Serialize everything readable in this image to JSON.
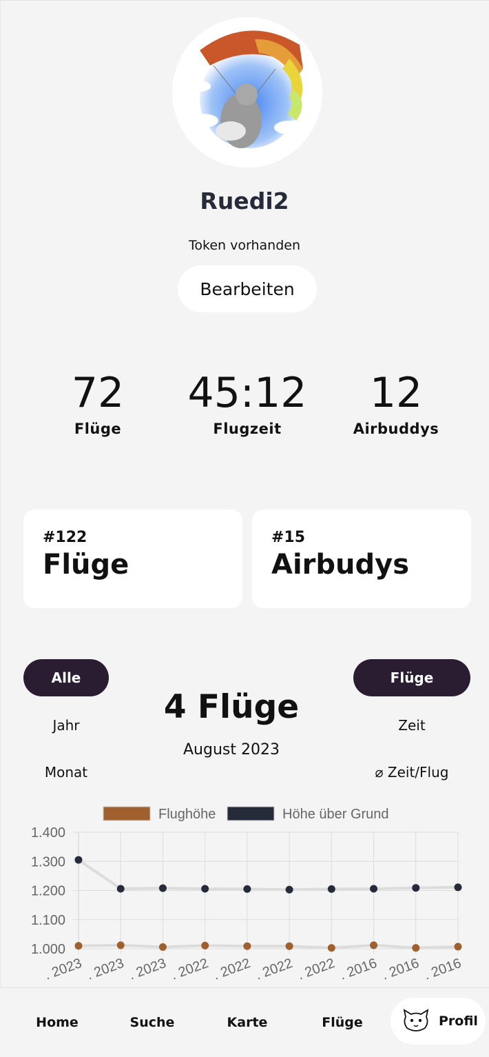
{
  "profile": {
    "username": "Ruedi2",
    "token_status": "Token vorhanden",
    "edit_label": "Bearbeiten"
  },
  "stats": [
    {
      "value": "72",
      "label": "Flüge"
    },
    {
      "value": "45:12",
      "label": "Flugzeit"
    },
    {
      "value": "12",
      "label": "Airbuddys"
    }
  ],
  "rankings": [
    {
      "rank": "#122",
      "title": "Flüge"
    },
    {
      "rank": "#15",
      "title": "Airbudys"
    }
  ],
  "filters": {
    "period_selected": "Alle",
    "period_options": [
      "Jahr",
      "Monat"
    ],
    "metric_selected": "Flüge",
    "metric_options": [
      "Zeit",
      "⌀ Zeit/Flug"
    ]
  },
  "summary": {
    "headline": "4 Flüge",
    "period": "August 2023"
  },
  "chart_data": {
    "type": "line",
    "legend_position": "top",
    "grid": true,
    "ylim": [
      1000,
      1400
    ],
    "yticks": [
      "1.000",
      "1.100",
      "1.200",
      "1.300",
      "1.400"
    ],
    "categories": [
      ". 2023",
      ". 2023",
      ". 2023",
      ". 2022",
      ". 2022",
      ". 2022",
      ". 2022",
      ". 2016",
      ". 2016",
      ". 2016"
    ],
    "series": [
      {
        "name": "Flughöhe",
        "color": "#a0602e",
        "values": [
          1010,
          1012,
          1006,
          1011,
          1009,
          1009,
          1003,
          1012,
          1003,
          1007
        ]
      },
      {
        "name": "Höhe über Grund",
        "color": "#262b3a",
        "values": [
          1305,
          1206,
          1208,
          1206,
          1205,
          1203,
          1205,
          1206,
          1209,
          1211
        ]
      }
    ]
  },
  "nav": {
    "home": "Home",
    "search": "Suche",
    "map": "Karte",
    "flights": "Flüge",
    "profile": "Profil",
    "active": "Profil"
  },
  "icons": {
    "avatar": "paraglider-cat-avatar",
    "profile_nav": "cat-avatar-icon"
  }
}
